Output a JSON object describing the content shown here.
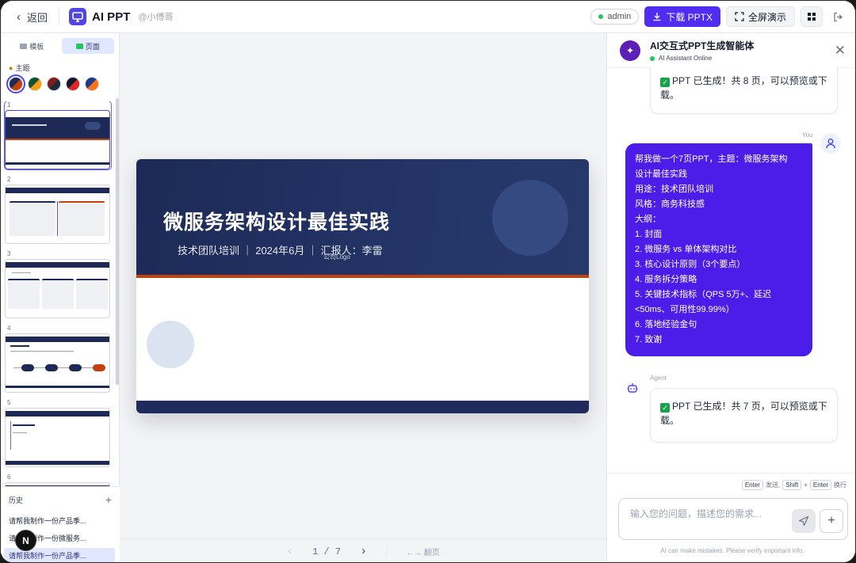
{
  "topbar": {
    "back_label": "返回",
    "app_title": "AI PPT",
    "app_user": "@小傅哥",
    "admin_label": "admin",
    "download_label": "下载 PPTX",
    "fullscreen_label": "全屏演示"
  },
  "sidebar": {
    "tabs": [
      {
        "label": "模板",
        "active": false
      },
      {
        "label": "页面",
        "active": true
      }
    ],
    "theme_label": "主题",
    "themes": [
      {
        "primary": "#1e2a55",
        "accent": "#c2410c",
        "active": true
      },
      {
        "primary": "#0f5132",
        "accent": "#f59e0b",
        "active": false
      },
      {
        "primary": "#7f1d1d",
        "accent": "#1e293b",
        "active": false
      },
      {
        "primary": "#111827",
        "accent": "#dc2626",
        "active": false
      },
      {
        "primary": "#1e3a8a",
        "accent": "#f97316",
        "active": false
      }
    ],
    "slide_numbers": [
      "1",
      "2",
      "3",
      "4",
      "5",
      "6"
    ],
    "active_slide": 0,
    "history_label": "历史",
    "history_items": [
      {
        "label": "请帮我制作一份产品季...",
        "active": false
      },
      {
        "label": "请帮我制作一份微服务...",
        "active": false
      },
      {
        "label": "请帮我制作一份产品季...",
        "active": true
      }
    ],
    "avatar_letter": "N"
  },
  "slide": {
    "title": "微服务架构设计最佳实践",
    "subtitle": "技术团队培训 ｜ 2024年6月 ｜ 汇报人：李雷",
    "logo": "公司Logo",
    "colors": {
      "header": "#1e2a55",
      "accent": "#c2410c"
    }
  },
  "pager": {
    "current": "1 / 7",
    "hint": "←→ 翻页"
  },
  "chat": {
    "title": "AI交互式PPT生成智能体",
    "status": "AI Assistant Online",
    "msg_top": "PPT 已生成！共 8 页，可以预览或下载。",
    "you_label": "You",
    "user_lines": [
      "帮我做一个7页PPT，主题：微服务架构",
      "设计最佳实践",
      "用途：技术团队培训",
      "风格：商务科技感",
      "大纲：",
      "1. 封面",
      "2. 微服务 vs 单体架构对比",
      "3. 核心设计原则（3个要点）",
      "4. 服务拆分策略",
      "5. 关键技术指标（QPS 5万+、延迟",
      "<50ms、可用性99.99%）",
      "6. 落地经验金句",
      "7. 致谢"
    ],
    "agent_label": "Agent",
    "msg_agent": "PPT 已生成！共 7 页，可以预览或下载。",
    "kbd": {
      "enter": "Enter",
      "send": "发送,",
      "shift": "Shift",
      "plus": "+",
      "enter2": "Enter",
      "newline": "换行"
    },
    "input_placeholder": "输入您的问题，描述您的需求...",
    "disclaimer": "AI can make mistakes. Please verify important info."
  }
}
